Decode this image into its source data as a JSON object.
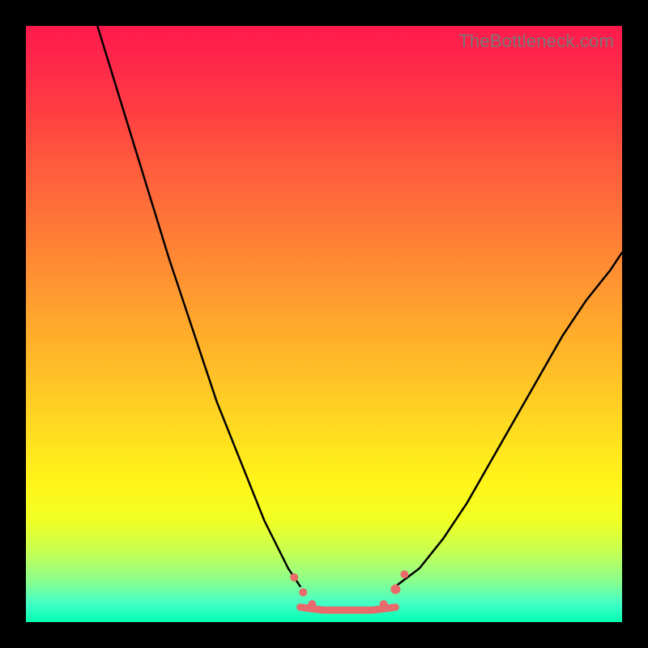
{
  "watermark": {
    "text": "TheBottleneck.com"
  },
  "chart_data": {
    "type": "line",
    "title": "",
    "xlabel": "",
    "ylabel": "",
    "xlim": [
      0,
      100
    ],
    "ylim": [
      0,
      100
    ],
    "grid": false,
    "legend": false,
    "series": [
      {
        "name": "left-curve",
        "color": "#000000",
        "x": [
          12,
          16,
          20,
          24,
          28,
          32,
          36,
          40,
          44,
          46
        ],
        "y": [
          100,
          87,
          74,
          61,
          49,
          37,
          27,
          17,
          9,
          6
        ]
      },
      {
        "name": "right-curve",
        "color": "#000000",
        "x": [
          62,
          66,
          70,
          74,
          78,
          82,
          86,
          90,
          94,
          98,
          100
        ],
        "y": [
          6,
          9,
          14,
          20,
          27,
          34,
          41,
          48,
          54,
          59,
          62
        ]
      },
      {
        "name": "floor-line",
        "color": "#e86a6a",
        "x": [
          46,
          50,
          54,
          58,
          62
        ],
        "y": [
          2.5,
          2,
          2,
          2,
          2.5
        ]
      }
    ],
    "markers": [
      {
        "name": "left-dot-1",
        "x": 45,
        "y": 7.5,
        "color": "#e86a6a",
        "r": 5
      },
      {
        "name": "left-dot-2",
        "x": 46.5,
        "y": 5,
        "color": "#e86a6a",
        "r": 5
      },
      {
        "name": "left-dot-3",
        "x": 48,
        "y": 3,
        "color": "#e86a6a",
        "r": 5
      },
      {
        "name": "right-dot-1",
        "x": 60,
        "y": 3,
        "color": "#e86a6a",
        "r": 5
      },
      {
        "name": "right-dot-2",
        "x": 62,
        "y": 5.5,
        "color": "#e86a6a",
        "r": 6
      },
      {
        "name": "right-dot-3",
        "x": 63.5,
        "y": 8,
        "color": "#e86a6a",
        "r": 5
      }
    ]
  }
}
